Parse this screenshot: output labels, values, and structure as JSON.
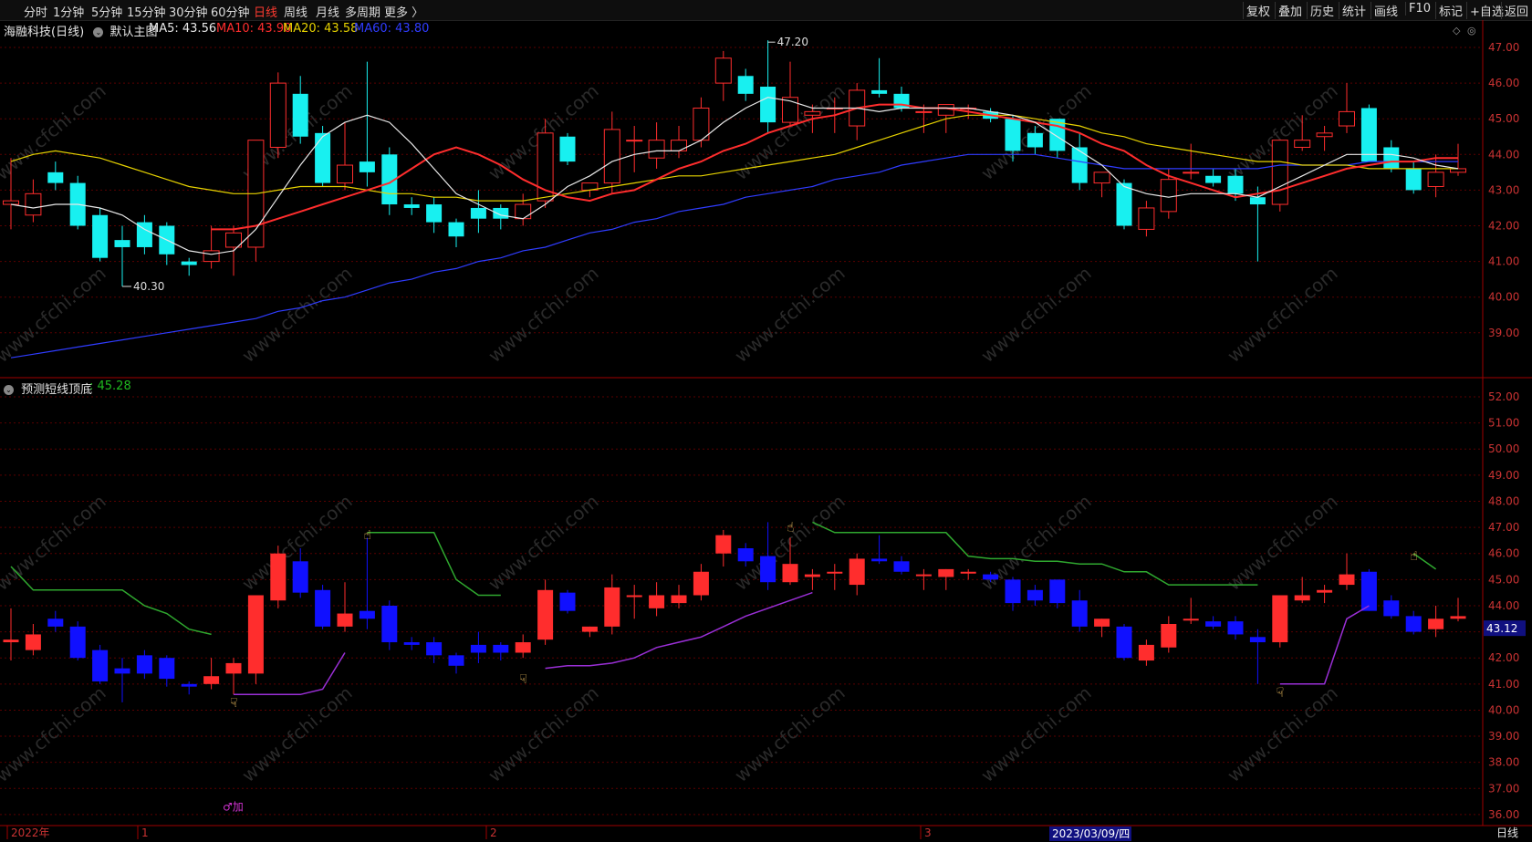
{
  "toolbar": {
    "periods": [
      "分时",
      "1分钟",
      "5分钟",
      "15分钟",
      "30分钟",
      "60分钟",
      "日线",
      "周线",
      "月线",
      "多周期",
      "更多 〉"
    ],
    "active_period": "日线",
    "right_buttons": [
      "复权",
      "叠加",
      "历史",
      "统计",
      "画线",
      "F10",
      "标记",
      "+自选",
      "返回"
    ]
  },
  "main_chart": {
    "stock_title": "海融科技(日线)",
    "template": "默认主图",
    "ma": [
      {
        "label": "MA5: 43.56",
        "color": "#e8e8e8"
      },
      {
        "label": "MA10: 43.90",
        "color": "#ff2d2d"
      },
      {
        "label": "MA20: 43.58",
        "color": "#e6d200"
      },
      {
        "label": "MA60: 43.80",
        "color": "#2f3cff"
      }
    ],
    "high_marker": "47.20",
    "low_marker": "40.30",
    "y_ticks": [
      "47.00",
      "46.00",
      "45.00",
      "44.00",
      "43.00",
      "42.00",
      "41.00",
      "40.00",
      "39.00"
    ]
  },
  "indicator": {
    "title": "预测短线顶底",
    "value": ": 45.28",
    "y_ticks": [
      "52.00",
      "51.00",
      "50.00",
      "49.00",
      "48.00",
      "47.00",
      "46.00",
      "45.00",
      "44.00",
      "43.00",
      "42.00",
      "41.00",
      "40.00",
      "39.00",
      "38.00",
      "37.00",
      "36.00"
    ],
    "price_badge": "43.12",
    "add_label": "♂加"
  },
  "x_axis": {
    "labels": [
      "2022年",
      "1",
      "2",
      "3"
    ],
    "cursor_date": "2023/03/09/四",
    "period": "日线"
  },
  "watermark": "www.cfchi.com",
  "colors": {
    "up": "#ff2d2d",
    "down_main": "#18f0f0",
    "down_indicator": "#1010ff",
    "grid": "#5a0000",
    "top_line": "#2fa82f",
    "bottom_line": "#9a2fd6"
  },
  "chart_data": {
    "type": "candlestick",
    "candles": [
      {
        "o": 42.6,
        "h": 43.9,
        "l": 41.9,
        "c": 42.7
      },
      {
        "o": 42.3,
        "h": 43.3,
        "l": 42.1,
        "c": 42.9
      },
      {
        "o": 43.5,
        "h": 43.8,
        "l": 43.0,
        "c": 43.2
      },
      {
        "o": 43.2,
        "h": 43.4,
        "l": 41.9,
        "c": 42.0
      },
      {
        "o": 42.3,
        "h": 42.5,
        "l": 41.0,
        "c": 41.1
      },
      {
        "o": 41.6,
        "h": 42.0,
        "l": 40.3,
        "c": 41.4
      },
      {
        "o": 42.1,
        "h": 42.3,
        "l": 41.2,
        "c": 41.4
      },
      {
        "o": 42.0,
        "h": 42.1,
        "l": 40.9,
        "c": 41.2
      },
      {
        "o": 41.0,
        "h": 41.1,
        "l": 40.6,
        "c": 40.9
      },
      {
        "o": 41.0,
        "h": 42.0,
        "l": 40.8,
        "c": 41.3
      },
      {
        "o": 41.4,
        "h": 42.0,
        "l": 40.6,
        "c": 41.8
      },
      {
        "o": 41.4,
        "h": 44.4,
        "l": 41.0,
        "c": 44.4
      },
      {
        "o": 44.2,
        "h": 46.3,
        "l": 43.9,
        "c": 46.0
      },
      {
        "o": 45.7,
        "h": 46.2,
        "l": 44.3,
        "c": 44.5
      },
      {
        "o": 44.6,
        "h": 44.8,
        "l": 43.1,
        "c": 43.2
      },
      {
        "o": 43.2,
        "h": 44.9,
        "l": 43.0,
        "c": 43.7
      },
      {
        "o": 43.8,
        "h": 46.6,
        "l": 43.1,
        "c": 43.5
      },
      {
        "o": 44.0,
        "h": 44.2,
        "l": 42.3,
        "c": 42.6
      },
      {
        "o": 42.6,
        "h": 42.8,
        "l": 42.3,
        "c": 42.5
      },
      {
        "o": 42.6,
        "h": 42.8,
        "l": 41.8,
        "c": 42.1
      },
      {
        "o": 42.1,
        "h": 42.2,
        "l": 41.4,
        "c": 41.7
      },
      {
        "o": 42.5,
        "h": 43.0,
        "l": 41.8,
        "c": 42.2
      },
      {
        "o": 42.5,
        "h": 42.6,
        "l": 41.9,
        "c": 42.2
      },
      {
        "o": 42.2,
        "h": 42.9,
        "l": 42.0,
        "c": 42.6
      },
      {
        "o": 42.7,
        "h": 45.0,
        "l": 42.5,
        "c": 44.6
      },
      {
        "o": 44.5,
        "h": 44.6,
        "l": 43.7,
        "c": 43.8
      },
      {
        "o": 43.0,
        "h": 43.2,
        "l": 42.8,
        "c": 43.2
      },
      {
        "o": 43.2,
        "h": 45.2,
        "l": 42.9,
        "c": 44.7
      },
      {
        "o": 44.4,
        "h": 44.8,
        "l": 43.5,
        "c": 44.4
      },
      {
        "o": 43.9,
        "h": 44.9,
        "l": 43.6,
        "c": 44.4
      },
      {
        "o": 44.1,
        "h": 44.8,
        "l": 43.9,
        "c": 44.4
      },
      {
        "o": 44.4,
        "h": 45.6,
        "l": 44.2,
        "c": 45.3
      },
      {
        "o": 46.0,
        "h": 46.9,
        "l": 45.5,
        "c": 46.7
      },
      {
        "o": 46.2,
        "h": 46.4,
        "l": 45.5,
        "c": 45.7
      },
      {
        "o": 45.9,
        "h": 47.2,
        "l": 44.6,
        "c": 44.9
      },
      {
        "o": 44.9,
        "h": 46.6,
        "l": 44.8,
        "c": 45.6
      },
      {
        "o": 45.1,
        "h": 45.4,
        "l": 44.6,
        "c": 45.2
      },
      {
        "o": 45.3,
        "h": 45.6,
        "l": 44.6,
        "c": 45.3
      },
      {
        "o": 44.8,
        "h": 46.0,
        "l": 44.4,
        "c": 45.8
      },
      {
        "o": 45.8,
        "h": 46.7,
        "l": 45.6,
        "c": 45.7
      },
      {
        "o": 45.7,
        "h": 45.9,
        "l": 45.2,
        "c": 45.3
      },
      {
        "o": 45.2,
        "h": 45.4,
        "l": 44.6,
        "c": 45.2
      },
      {
        "o": 45.1,
        "h": 45.4,
        "l": 44.6,
        "c": 45.4
      },
      {
        "o": 45.3,
        "h": 45.4,
        "l": 45.0,
        "c": 45.3
      },
      {
        "o": 45.2,
        "h": 45.3,
        "l": 44.9,
        "c": 45.0
      },
      {
        "o": 45.0,
        "h": 45.1,
        "l": 43.8,
        "c": 44.1
      },
      {
        "o": 44.6,
        "h": 44.8,
        "l": 44.0,
        "c": 44.2
      },
      {
        "o": 45.0,
        "h": 45.0,
        "l": 43.9,
        "c": 44.1
      },
      {
        "o": 44.2,
        "h": 44.6,
        "l": 43.0,
        "c": 43.2
      },
      {
        "o": 43.2,
        "h": 43.5,
        "l": 42.8,
        "c": 43.5
      },
      {
        "o": 43.2,
        "h": 43.3,
        "l": 41.9,
        "c": 42.0
      },
      {
        "o": 41.9,
        "h": 42.7,
        "l": 41.7,
        "c": 42.5
      },
      {
        "o": 42.4,
        "h": 43.6,
        "l": 42.2,
        "c": 43.3
      },
      {
        "o": 43.5,
        "h": 44.3,
        "l": 43.3,
        "c": 43.5
      },
      {
        "o": 43.4,
        "h": 43.6,
        "l": 43.1,
        "c": 43.2
      },
      {
        "o": 43.4,
        "h": 43.6,
        "l": 42.7,
        "c": 42.9
      },
      {
        "o": 42.8,
        "h": 43.1,
        "l": 41.0,
        "c": 42.6
      },
      {
        "o": 42.6,
        "h": 44.4,
        "l": 42.4,
        "c": 44.4
      },
      {
        "o": 44.2,
        "h": 45.1,
        "l": 44.1,
        "c": 44.4
      },
      {
        "o": 44.5,
        "h": 44.8,
        "l": 44.1,
        "c": 44.6
      },
      {
        "o": 44.8,
        "h": 46.0,
        "l": 44.6,
        "c": 45.2
      },
      {
        "o": 45.3,
        "h": 45.4,
        "l": 43.8,
        "c": 43.8
      },
      {
        "o": 44.2,
        "h": 44.4,
        "l": 43.5,
        "c": 43.6
      },
      {
        "o": 43.6,
        "h": 43.8,
        "l": 42.9,
        "c": 43.0
      },
      {
        "o": 43.1,
        "h": 44.0,
        "l": 42.8,
        "c": 43.5
      },
      {
        "o": 43.5,
        "h": 44.3,
        "l": 43.4,
        "c": 43.6
      }
    ],
    "ma5": [
      42.6,
      42.5,
      42.6,
      42.6,
      42.5,
      42.3,
      41.9,
      41.6,
      41.3,
      41.2,
      41.3,
      41.9,
      42.8,
      43.7,
      44.5,
      44.9,
      45.1,
      44.9,
      44.3,
      43.6,
      42.9,
      42.6,
      42.3,
      42.2,
      42.6,
      43.1,
      43.4,
      43.8,
      44.0,
      44.1,
      44.1,
      44.4,
      44.9,
      45.3,
      45.6,
      45.5,
      45.3,
      45.3,
      45.3,
      45.2,
      45.3,
      45.3,
      45.3,
      45.3,
      45.2,
      45.1,
      44.9,
      44.5,
      44.1,
      43.7,
      43.1,
      42.9,
      42.8,
      42.9,
      42.9,
      42.9,
      42.8,
      43.1,
      43.4,
      43.7,
      44.0,
      44.0,
      44.0,
      43.9,
      43.7,
      43.6
    ],
    "ma10": [
      null,
      null,
      null,
      null,
      null,
      null,
      null,
      null,
      null,
      41.9,
      41.9,
      42.0,
      42.2,
      42.4,
      42.6,
      42.8,
      43.0,
      43.2,
      43.6,
      44.0,
      44.2,
      44.0,
      43.7,
      43.3,
      43.0,
      42.8,
      42.7,
      42.9,
      43.0,
      43.3,
      43.6,
      43.8,
      44.1,
      44.3,
      44.6,
      44.8,
      45.0,
      45.1,
      45.3,
      45.4,
      45.4,
      45.3,
      45.3,
      45.2,
      45.1,
      45.0,
      44.9,
      44.8,
      44.6,
      44.3,
      44.1,
      43.7,
      43.4,
      43.2,
      43.0,
      42.8,
      42.9,
      43.0,
      43.2,
      43.4,
      43.6,
      43.7,
      43.8,
      43.8,
      43.9,
      43.9
    ],
    "ma20": [
      43.8,
      44.0,
      44.1,
      44.0,
      43.9,
      43.7,
      43.5,
      43.3,
      43.1,
      43.0,
      42.9,
      42.9,
      43.0,
      43.1,
      43.1,
      43.1,
      43.0,
      42.9,
      42.9,
      42.8,
      42.8,
      42.7,
      42.7,
      42.7,
      42.8,
      42.9,
      43.0,
      43.1,
      43.2,
      43.3,
      43.4,
      43.4,
      43.5,
      43.6,
      43.7,
      43.8,
      43.9,
      44.0,
      44.2,
      44.4,
      44.6,
      44.8,
      45.0,
      45.1,
      45.1,
      45.1,
      45.0,
      44.9,
      44.8,
      44.6,
      44.5,
      44.3,
      44.2,
      44.1,
      44.0,
      43.9,
      43.8,
      43.8,
      43.7,
      43.7,
      43.7,
      43.6,
      43.6,
      43.6,
      43.6,
      43.6
    ],
    "ma60": [
      38.3,
      38.4,
      38.5,
      38.6,
      38.7,
      38.8,
      38.9,
      39.0,
      39.1,
      39.2,
      39.3,
      39.4,
      39.6,
      39.7,
      39.9,
      40.0,
      40.2,
      40.4,
      40.5,
      40.7,
      40.8,
      41.0,
      41.1,
      41.3,
      41.4,
      41.6,
      41.8,
      41.9,
      42.1,
      42.2,
      42.4,
      42.5,
      42.6,
      42.8,
      42.9,
      43.0,
      43.1,
      43.3,
      43.4,
      43.5,
      43.7,
      43.8,
      43.9,
      44.0,
      44.0,
      44.0,
      44.0,
      43.9,
      43.8,
      43.7,
      43.6,
      43.6,
      43.6,
      43.6,
      43.6,
      43.6,
      43.6,
      43.7,
      43.7,
      43.7,
      43.7,
      43.8,
      43.8,
      43.8,
      43.8,
      43.8
    ],
    "top_line": [
      [
        0,
        45.5
      ],
      [
        1,
        44.6
      ],
      [
        2,
        44.6
      ],
      [
        3,
        44.6
      ],
      [
        4,
        44.6
      ],
      [
        5,
        44.6
      ],
      [
        6,
        44.0
      ],
      [
        7,
        43.7
      ],
      [
        8,
        43.1
      ],
      [
        9,
        42.9
      ],
      [
        null,
        null
      ],
      [
        16,
        46.8
      ],
      [
        17,
        46.8
      ],
      [
        18,
        46.8
      ],
      [
        19,
        46.8
      ],
      [
        20,
        45.0
      ],
      [
        21,
        44.4
      ],
      [
        22,
        44.4
      ],
      [
        null,
        null
      ],
      [
        36,
        47.2
      ],
      [
        37,
        46.8
      ],
      [
        38,
        46.8
      ],
      [
        39,
        46.8
      ],
      [
        40,
        46.8
      ],
      [
        41,
        46.8
      ],
      [
        42,
        46.8
      ],
      [
        43,
        45.9
      ],
      [
        44,
        45.8
      ],
      [
        45,
        45.8
      ],
      [
        46,
        45.7
      ],
      [
        47,
        45.7
      ],
      [
        48,
        45.6
      ],
      [
        49,
        45.6
      ],
      [
        50,
        45.3
      ],
      [
        51,
        45.3
      ],
      [
        52,
        44.8
      ],
      [
        53,
        44.8
      ],
      [
        54,
        44.8
      ],
      [
        55,
        44.8
      ],
      [
        56,
        44.8
      ],
      [
        null,
        null
      ],
      [
        63,
        46.0
      ],
      [
        64,
        45.4
      ]
    ],
    "bottom_line": [
      [
        10,
        40.6
      ],
      [
        11,
        40.6
      ],
      [
        12,
        40.6
      ],
      [
        13,
        40.6
      ],
      [
        14,
        40.8
      ],
      [
        15,
        42.2
      ],
      [
        null,
        null
      ],
      [
        24,
        41.6
      ],
      [
        25,
        41.7
      ],
      [
        26,
        41.7
      ],
      [
        27,
        41.8
      ],
      [
        28,
        42.0
      ],
      [
        29,
        42.4
      ],
      [
        30,
        42.6
      ],
      [
        31,
        42.8
      ],
      [
        32,
        43.2
      ],
      [
        33,
        43.6
      ],
      [
        34,
        43.9
      ],
      [
        35,
        44.2
      ],
      [
        36,
        44.5
      ],
      [
        null,
        null
      ],
      [
        57,
        41.0
      ],
      [
        58,
        41.0
      ],
      [
        59,
        41.0
      ],
      [
        60,
        43.5
      ],
      [
        61,
        44.0
      ]
    ],
    "title": "",
    "xlabel": "",
    "ylabel": ""
  }
}
